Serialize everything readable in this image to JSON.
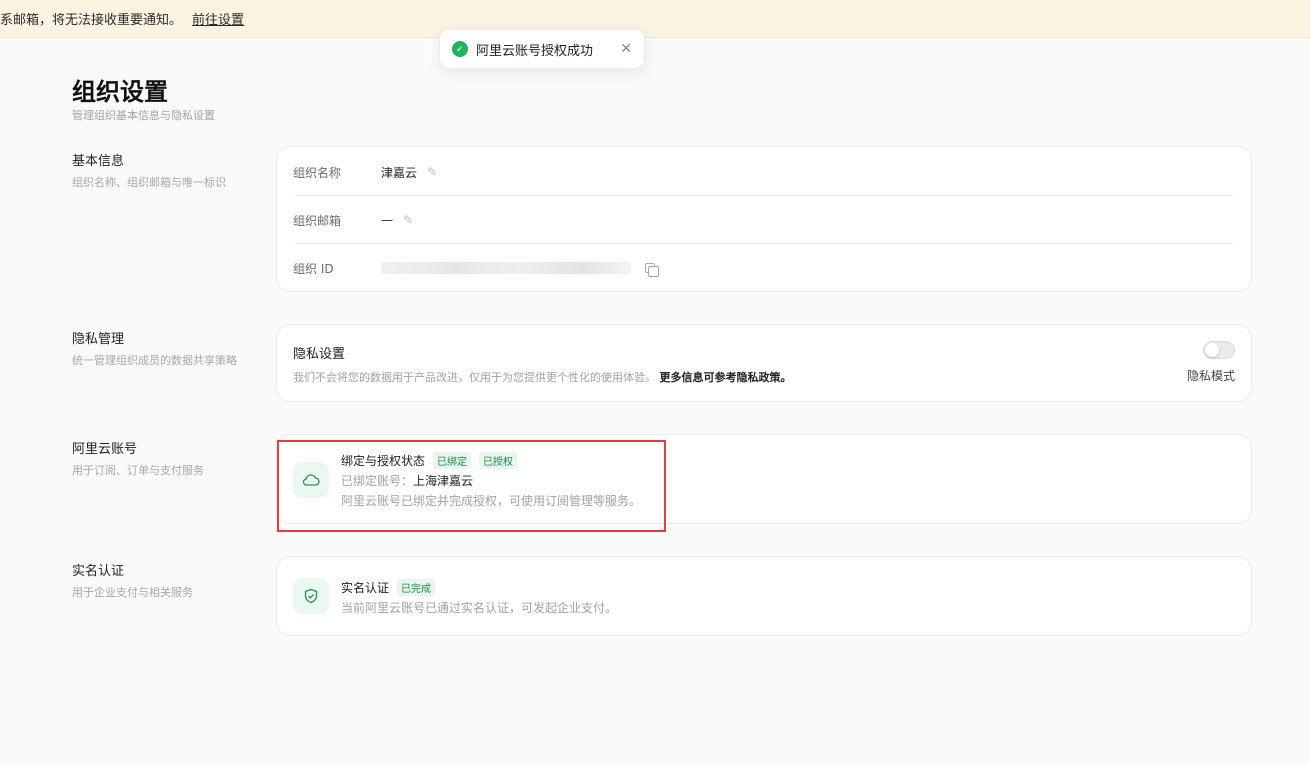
{
  "banner": {
    "text": "系邮箱，将无法接收重要通知。",
    "link": "前往设置"
  },
  "toast": {
    "message": "阿里云账号授权成功",
    "close": "✕"
  },
  "page": {
    "title": "组织设置",
    "subtitle": "管理组织基本信息与隐私设置"
  },
  "basic": {
    "label": "基本信息",
    "desc": "组织名称、组织邮箱与唯一标识",
    "rows": [
      {
        "key": "组织名称",
        "value": "津嘉云"
      },
      {
        "key": "组织邮箱",
        "value": "—"
      },
      {
        "key": "组织 ID",
        "value": ""
      }
    ]
  },
  "privacy": {
    "label": "隐私管理",
    "desc": "统一管理组织成员的数据共享策略",
    "card_title": "隐私设置",
    "card_desc": "我们不会将您的数据用于产品改进，仅用于为您提供更个性化的使用体验。",
    "card_desc_strong": "更多信息可参考隐私政策。",
    "toggle_label": "隐私模式",
    "toggle_on": false
  },
  "aliyun": {
    "label": "阿里云账号",
    "desc": "用于订阅、订单与支付服务",
    "title": "绑定与授权状态",
    "tags": [
      "已绑定",
      "已授权"
    ],
    "bound_label": "已绑定账号：",
    "bound_value": "上海津嘉云",
    "note": "阿里云账号已绑定并完成授权，可使用订阅管理等服务。"
  },
  "realname": {
    "label": "实名认证",
    "desc": "用于企业支付与相关服务",
    "title": "实名认证",
    "tag": "已完成",
    "note": "当前阿里云账号已通过实名认证，可发起企业支付。"
  },
  "colors": {
    "accent": "#22b35e",
    "highlight": "#e43d3d",
    "banner": "#fbf3e1"
  }
}
